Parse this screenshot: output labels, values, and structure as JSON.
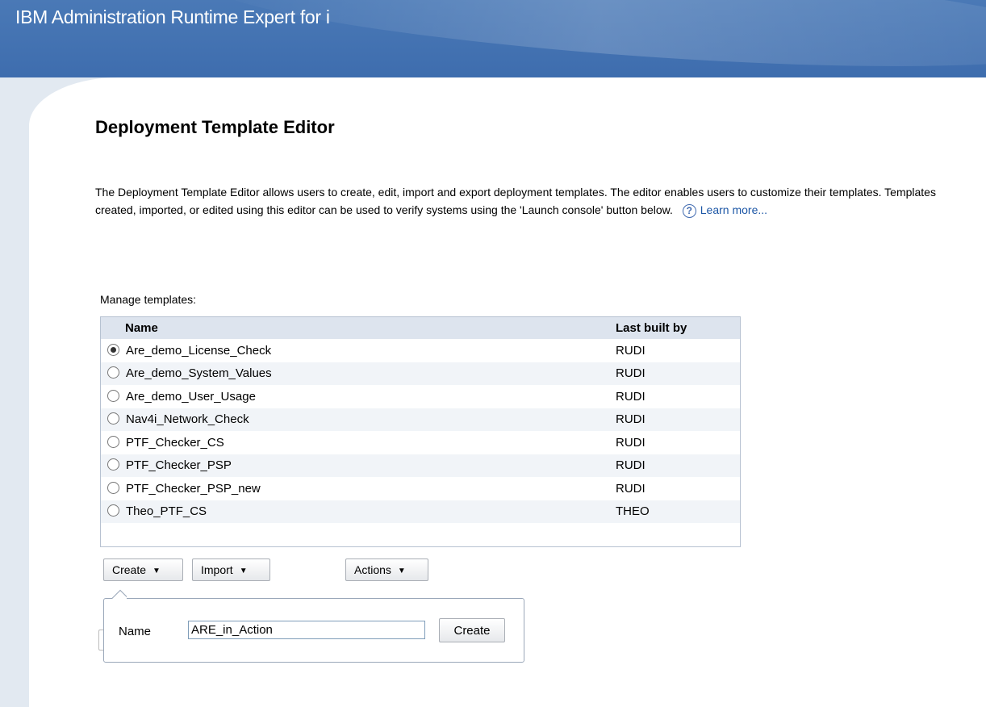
{
  "app": {
    "title": "IBM Administration Runtime Expert for i"
  },
  "page": {
    "title": "Deployment Template Editor",
    "description": "The Deployment Template Editor allows users to create, edit, import and export deployment templates. The editor enables users to customize their templates. Templates created, imported, or edited using this editor can be used to verify systems using the 'Launch console' button below.",
    "help_icon": "?",
    "learn_more": "Learn more..."
  },
  "templates": {
    "label": "Manage templates:",
    "columns": {
      "name": "Name",
      "last_built_by": "Last built by"
    },
    "rows": [
      {
        "name": "Are_demo_License_Check",
        "built_by": "RUDI",
        "selected": true
      },
      {
        "name": "Are_demo_System_Values",
        "built_by": "RUDI",
        "selected": false
      },
      {
        "name": "Are_demo_User_Usage",
        "built_by": "RUDI",
        "selected": false
      },
      {
        "name": "Nav4i_Network_Check",
        "built_by": "RUDI",
        "selected": false
      },
      {
        "name": "PTF_Checker_CS",
        "built_by": "RUDI",
        "selected": false
      },
      {
        "name": "PTF_Checker_PSP",
        "built_by": "RUDI",
        "selected": false
      },
      {
        "name": "PTF_Checker_PSP_new",
        "built_by": "RUDI",
        "selected": false
      },
      {
        "name": "Theo_PTF_CS",
        "built_by": "THEO",
        "selected": false
      }
    ]
  },
  "toolbar": {
    "create_label": "Create",
    "import_label": "Import",
    "actions_label": "Actions",
    "caret": "▼"
  },
  "create_popup": {
    "name_label": "Name",
    "name_value": "ARE_in_Action",
    "submit_label": "Create"
  }
}
